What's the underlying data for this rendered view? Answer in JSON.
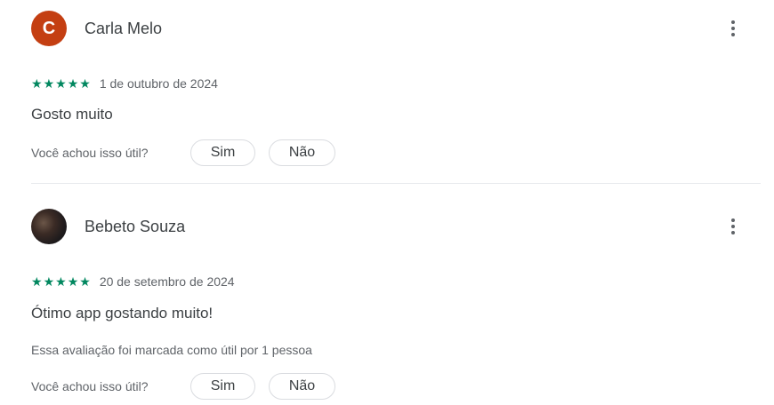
{
  "reviews": [
    {
      "reviewer": "Carla Melo",
      "avatar_letter": "C",
      "rating": 5,
      "stars": [
        "★",
        "★",
        "★",
        "★",
        "★"
      ],
      "date": "1 de outubro de 2024",
      "text": "Gosto muito",
      "helpful_count_text": "",
      "helpful_question": "Você achou isso útil?",
      "yes_label": "Sim",
      "no_label": "Não"
    },
    {
      "reviewer": "Bebeto Souza",
      "avatar_letter": "",
      "rating": 5,
      "stars": [
        "★",
        "★",
        "★",
        "★",
        "★"
      ],
      "date": "20 de setembro de 2024",
      "text": "Ótimo app gostando muito!",
      "helpful_count_text": "Essa avaliação foi marcada como útil por 1 pessoa",
      "helpful_question": "Você achou isso útil?",
      "yes_label": "Sim",
      "no_label": "Não"
    }
  ],
  "colors": {
    "star": "#01875f",
    "avatar_letter_bg": "#c43f12",
    "divider": "#e8eaed"
  },
  "icons": {
    "menu": "more-vert-icon",
    "star": "star-icon"
  }
}
